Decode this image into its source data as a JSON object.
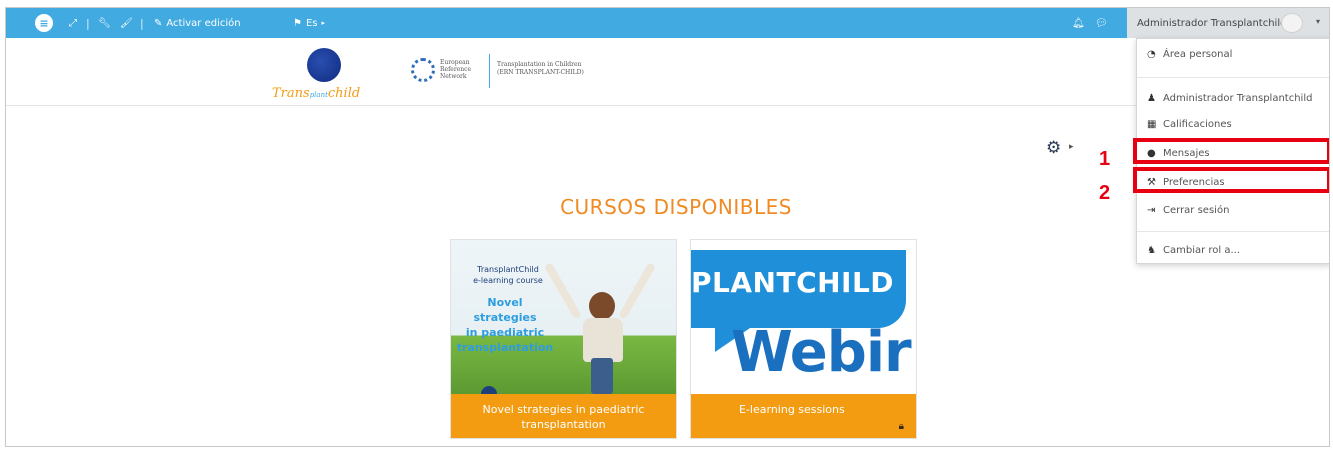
{
  "navbar": {
    "edit_label": "Activar edición",
    "language_label": "Es",
    "language_caret": "▸",
    "user_name": "Administrador Transplantchild",
    "user_caret": "▾"
  },
  "header": {
    "logo_word": "Trans",
    "logo_word_small": "plant",
    "logo_word_end": "child",
    "ern_line1": "European",
    "ern_line2": "Reference",
    "ern_line3": "Network",
    "tic_line1": "Transplantation in Children",
    "tic_line2": "(ERN TRANSPLANT-CHILD)"
  },
  "main": {
    "gear_caret": "▸",
    "section_title": "CURSOS DISPONIBLES",
    "courses": [
      {
        "image_small_line1": "TransplantChild",
        "image_small_line2": "e-learning course",
        "image_big_line1": "Novel",
        "image_big_line2": "strategies",
        "image_big_line3": "in paediatric",
        "image_big_line4": "transplantation",
        "footer_line1": "Novel strategies in paediatric",
        "footer_line2": "transplantation"
      },
      {
        "image_word": "PLANTCHILD",
        "image_word2": "Webir",
        "footer": "E-learning sessions"
      }
    ]
  },
  "dropdown": {
    "items": [
      {
        "label": "Área personal",
        "icon": "dashboard-icon"
      },
      {
        "label": "Administrador Transplantchild",
        "icon": "user-icon"
      },
      {
        "label": "Calificaciones",
        "icon": "table-icon"
      },
      {
        "label": "Mensajes",
        "icon": "chat-icon"
      },
      {
        "label": "Preferencias",
        "icon": "wrench-icon"
      },
      {
        "label": "Cerrar sesión",
        "icon": "logout-icon"
      },
      {
        "label": "Cambiar rol a...",
        "icon": "user-secret-icon"
      }
    ]
  },
  "annotations": {
    "label1": "1",
    "label2": "2",
    "color": "#e60012"
  },
  "colors": {
    "navbar": "#41aae1",
    "accent": "#f39c12",
    "title": "#f08a24"
  }
}
